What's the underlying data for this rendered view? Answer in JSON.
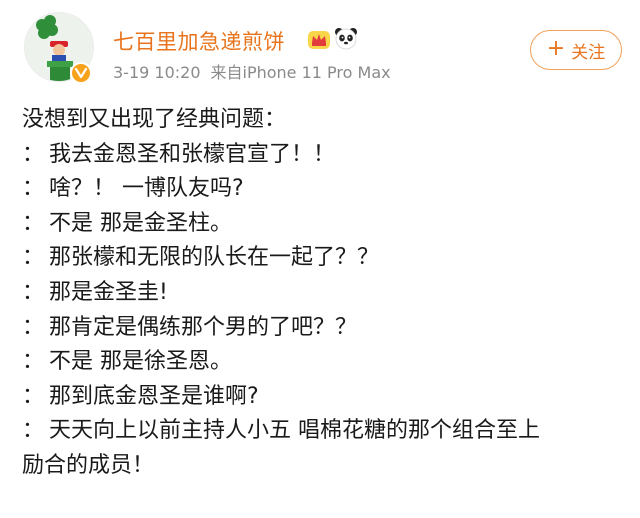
{
  "post": {
    "author": {
      "name": "七百里加急递煎饼",
      "avatar_icon": "mario-pipe-avatar",
      "verified_icon": "verified-badge-icon",
      "badges": [
        "crown-icon",
        "panda-icon"
      ]
    },
    "meta": {
      "date": "3-19 10:20",
      "source": "来自iPhone 11 Pro Max"
    },
    "follow_button": {
      "icon": "+",
      "label": "关注"
    },
    "body": {
      "intro": "没想到又出现了经典问题：",
      "lines": [
        {
          "prefix": "：",
          "text": "我去金恩圣和张檬官宣了！！"
        },
        {
          "prefix": "：",
          "text": "啥？！ 一博队友吗?"
        },
        {
          "prefix": "：",
          "text": "不是 那是金圣柱。"
        },
        {
          "prefix": "：",
          "text": "那张檬和无限的队长在一起了？？"
        },
        {
          "prefix": "：",
          "text": "那是金圣圭!"
        },
        {
          "prefix": "：",
          "text": "那肯定是偶练那个男的了吧？？"
        },
        {
          "prefix": "：",
          "text": "不是 那是徐圣恩。"
        },
        {
          "prefix": "：",
          "text": "那到底金恩圣是谁啊?"
        },
        {
          "prefix": "：",
          "text": "天天向上以前主持人小五 唱棉花糖的那个组合至上"
        }
      ],
      "continuation": "励合的成员！"
    }
  },
  "colors": {
    "username": "#e8741d",
    "meta": "#8a8a8a",
    "follow_border": "#f0a15a",
    "body_text": "#1a1a1a"
  }
}
